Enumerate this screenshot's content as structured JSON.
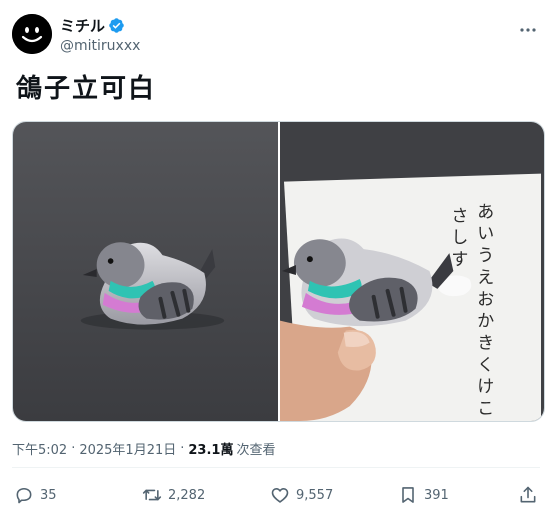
{
  "author": {
    "display_name": "ミチル",
    "handle": "@mitiruxxx",
    "verified_icon": "verified-badge-icon",
    "avatar_icon": "smiley-face-avatar"
  },
  "more_icon": "more-dots-icon",
  "tweet": {
    "text": "鴿子立可白"
  },
  "media": {
    "left_photo": "clay-pigeon-figurine",
    "right_photo": {
      "icon": "pigeon-correction-tape-on-paper",
      "paper_line_1": "あいうえおかきくけこ",
      "paper_line_2": "さしす"
    }
  },
  "meta": {
    "time": "下午5:02",
    "separator": "·",
    "date": "2025年1月21日",
    "separator2": "·",
    "views_count": "23.1萬",
    "views_label": "次查看"
  },
  "actions": {
    "reply_count": "35",
    "retweet_count": "2,282",
    "like_count": "9,557",
    "bookmark_count": "391"
  },
  "colors": {
    "text": "#0f1419",
    "secondary": "#536471",
    "verified": "#1d9bf0",
    "border": "#cfd9de"
  }
}
